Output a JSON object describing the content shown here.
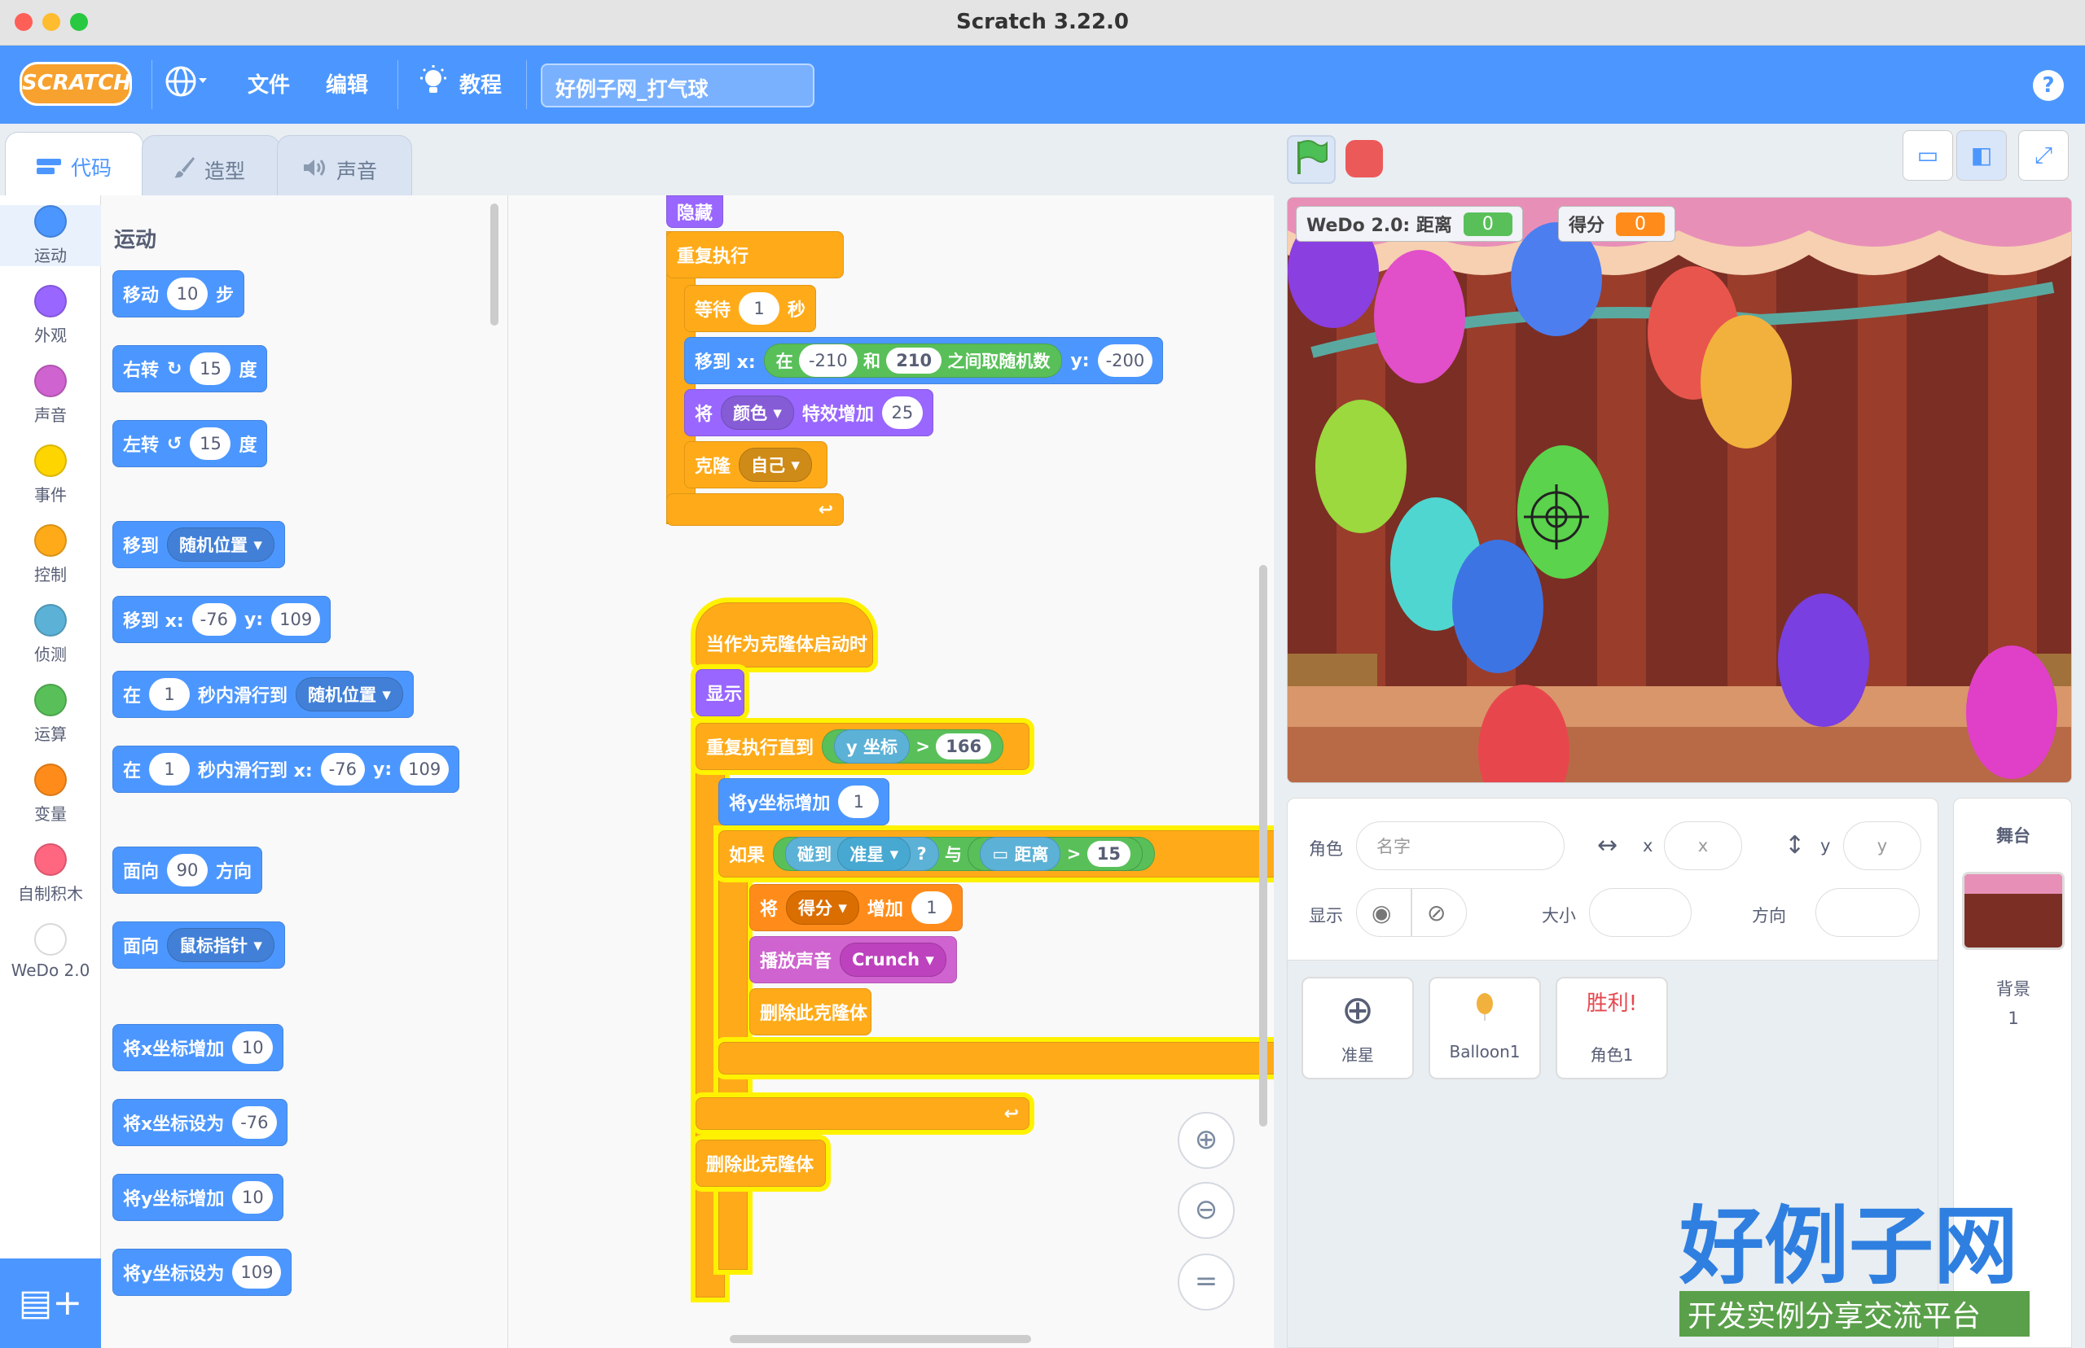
{
  "window": {
    "title": "Scratch 3.22.0"
  },
  "menu": {
    "logo": "SCRATCH",
    "file": "文件",
    "edit": "编辑",
    "tutorials": "教程",
    "project_title": "好例子网_打气球",
    "help": "?"
  },
  "tabs": {
    "code": "代码",
    "costumes": "造型",
    "sounds": "声音"
  },
  "categories": [
    {
      "label": "运动",
      "color": "#4c97ff"
    },
    {
      "label": "外观",
      "color": "#9966ff"
    },
    {
      "label": "声音",
      "color": "#cf63cf"
    },
    {
      "label": "事件",
      "color": "#ffd500"
    },
    {
      "label": "控制",
      "color": "#ffab19"
    },
    {
      "label": "侦测",
      "color": "#5cb1d6"
    },
    {
      "label": "运算",
      "color": "#59c059"
    },
    {
      "label": "变量",
      "color": "#ff8c1a"
    },
    {
      "label": "自制积木",
      "color": "#ff6680"
    },
    {
      "label": "WeDo 2.0",
      "color": "#ffffff"
    }
  ],
  "palette": {
    "heading": "运动",
    "move": {
      "a": "移动",
      "v": "10",
      "b": "步"
    },
    "turn_right": {
      "a": "右转",
      "v": "15",
      "b": "度"
    },
    "turn_left": {
      "a": "左转",
      "v": "15",
      "b": "度"
    },
    "goto": {
      "a": "移到",
      "dd": "随机位置"
    },
    "goto_xy": {
      "a": "移到 x:",
      "x": "-76",
      "b": "y:",
      "y": "109"
    },
    "glide": {
      "a": "在",
      "v": "1",
      "b": "秒内滑行到",
      "dd": "随机位置"
    },
    "glide_xy": {
      "a": "在",
      "v": "1",
      "b": "秒内滑行到 x:",
      "x": "-76",
      "c": "y:",
      "y": "109"
    },
    "point_dir": {
      "a": "面向",
      "v": "90",
      "b": "方向"
    },
    "point_towards": {
      "a": "面向",
      "dd": "鼠标指针"
    },
    "change_x": {
      "a": "将x坐标增加",
      "v": "10"
    },
    "set_x": {
      "a": "将x坐标设为",
      "v": "-76"
    },
    "change_y": {
      "a": "将y坐标增加",
      "v": "10"
    },
    "set_y": {
      "a": "将y坐标设为",
      "v": "109"
    }
  },
  "script1": {
    "hide": "隐藏",
    "forever": "重复执行",
    "wait": {
      "a": "等待",
      "v": "1",
      "b": "秒"
    },
    "goto": {
      "a": "移到 x:",
      "b": "在",
      "lo": "-210",
      "c": "和",
      "hi": "210",
      "d": "之间取随机数",
      "e": "y:",
      "y": "-200"
    },
    "effect": {
      "a": "将",
      "dd": "颜色",
      "b": "特效增加",
      "v": "25"
    },
    "clone": {
      "a": "克隆",
      "dd": "自己"
    }
  },
  "script2": {
    "hat": "当作为克隆体启动时",
    "show": "显示",
    "repeat_until": {
      "a": "重复执行直到",
      "var": "y 坐标",
      "op": ">",
      "v": "166"
    },
    "change_y": {
      "a": "将y坐标增加",
      "v": "1"
    },
    "if": {
      "a": "如果",
      "touch": "碰到",
      "dd": "准星",
      "q": "?",
      "and": "与",
      "dist": "距离",
      "op": ">",
      "v": "15"
    },
    "change_score": {
      "a": "将",
      "dd": "得分",
      "b": "增加",
      "v": "1"
    },
    "play": {
      "a": "播放声音",
      "dd": "Crunch"
    },
    "delete1": "删除此克隆体",
    "delete2": "删除此克隆体"
  },
  "monitors": {
    "wedo": {
      "label": "WeDo 2.0: 距离",
      "value": "0"
    },
    "score": {
      "label": "得分",
      "value": "0"
    }
  },
  "sprite_info": {
    "sprite": "角色",
    "name_placeholder": "名字",
    "x": "x",
    "x_ph": "x",
    "y": "y",
    "y_ph": "y",
    "show": "显示",
    "size": "大小",
    "direction": "方向"
  },
  "sprites": [
    {
      "name": "准星"
    },
    {
      "name": "Balloon1"
    },
    {
      "name": "角色1",
      "thumb": "胜利!"
    }
  ],
  "stage_pane": {
    "title": "舞台",
    "backdrops_label": "背景",
    "backdrops_count": "1"
  },
  "watermark": {
    "brand": "好例子网",
    "tagline": "开发实例分享交流平台"
  }
}
